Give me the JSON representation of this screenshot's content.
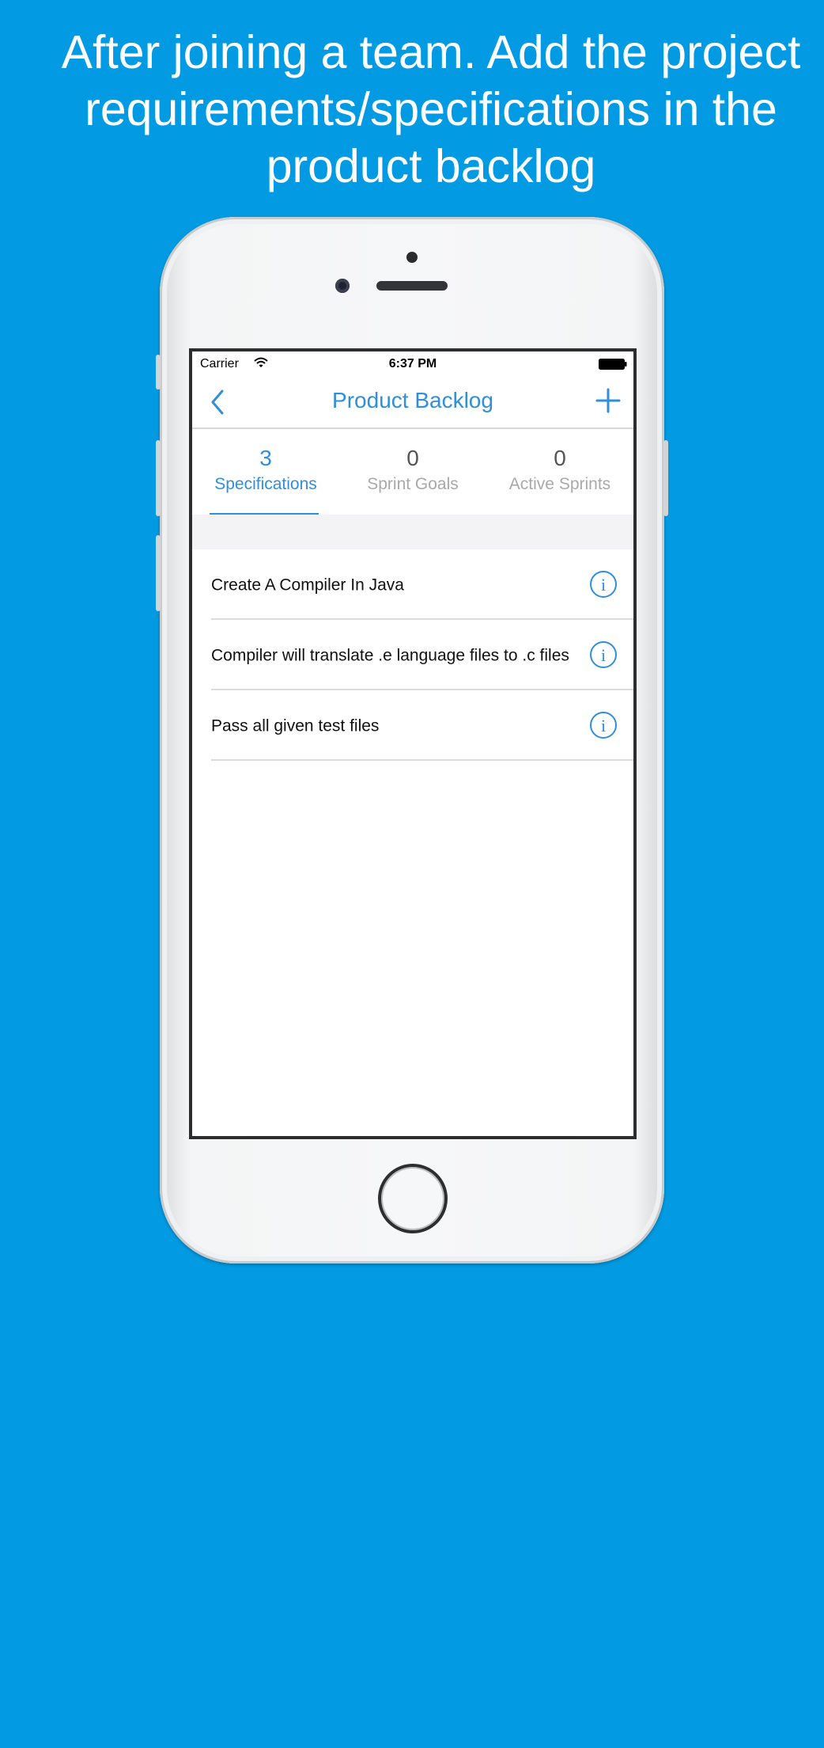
{
  "headline": {
    "line1": "After joining a team. Add the project",
    "line2": "requirements/specifications in the",
    "line3": "product backlog"
  },
  "colors": {
    "background": "#029be3",
    "accent": "#2f8fdc"
  },
  "status_bar": {
    "carrier": "Carrier",
    "time": "6:37 PM"
  },
  "navbar": {
    "title": "Product Backlog",
    "back_icon": "chevron-left-icon",
    "add_icon": "plus-icon"
  },
  "tabs": [
    {
      "count": "3",
      "label": "Specifications",
      "active": true
    },
    {
      "count": "0",
      "label": "Sprint Goals",
      "active": false
    },
    {
      "count": "0",
      "label": "Active Sprints",
      "active": false
    }
  ],
  "specifications": [
    {
      "text": "Create A Compiler In Java",
      "icon": "info-icon"
    },
    {
      "text": "Compiler will translate .e language files to .c files",
      "icon": "info-icon"
    },
    {
      "text": "Pass all given test files",
      "icon": "info-icon"
    }
  ]
}
